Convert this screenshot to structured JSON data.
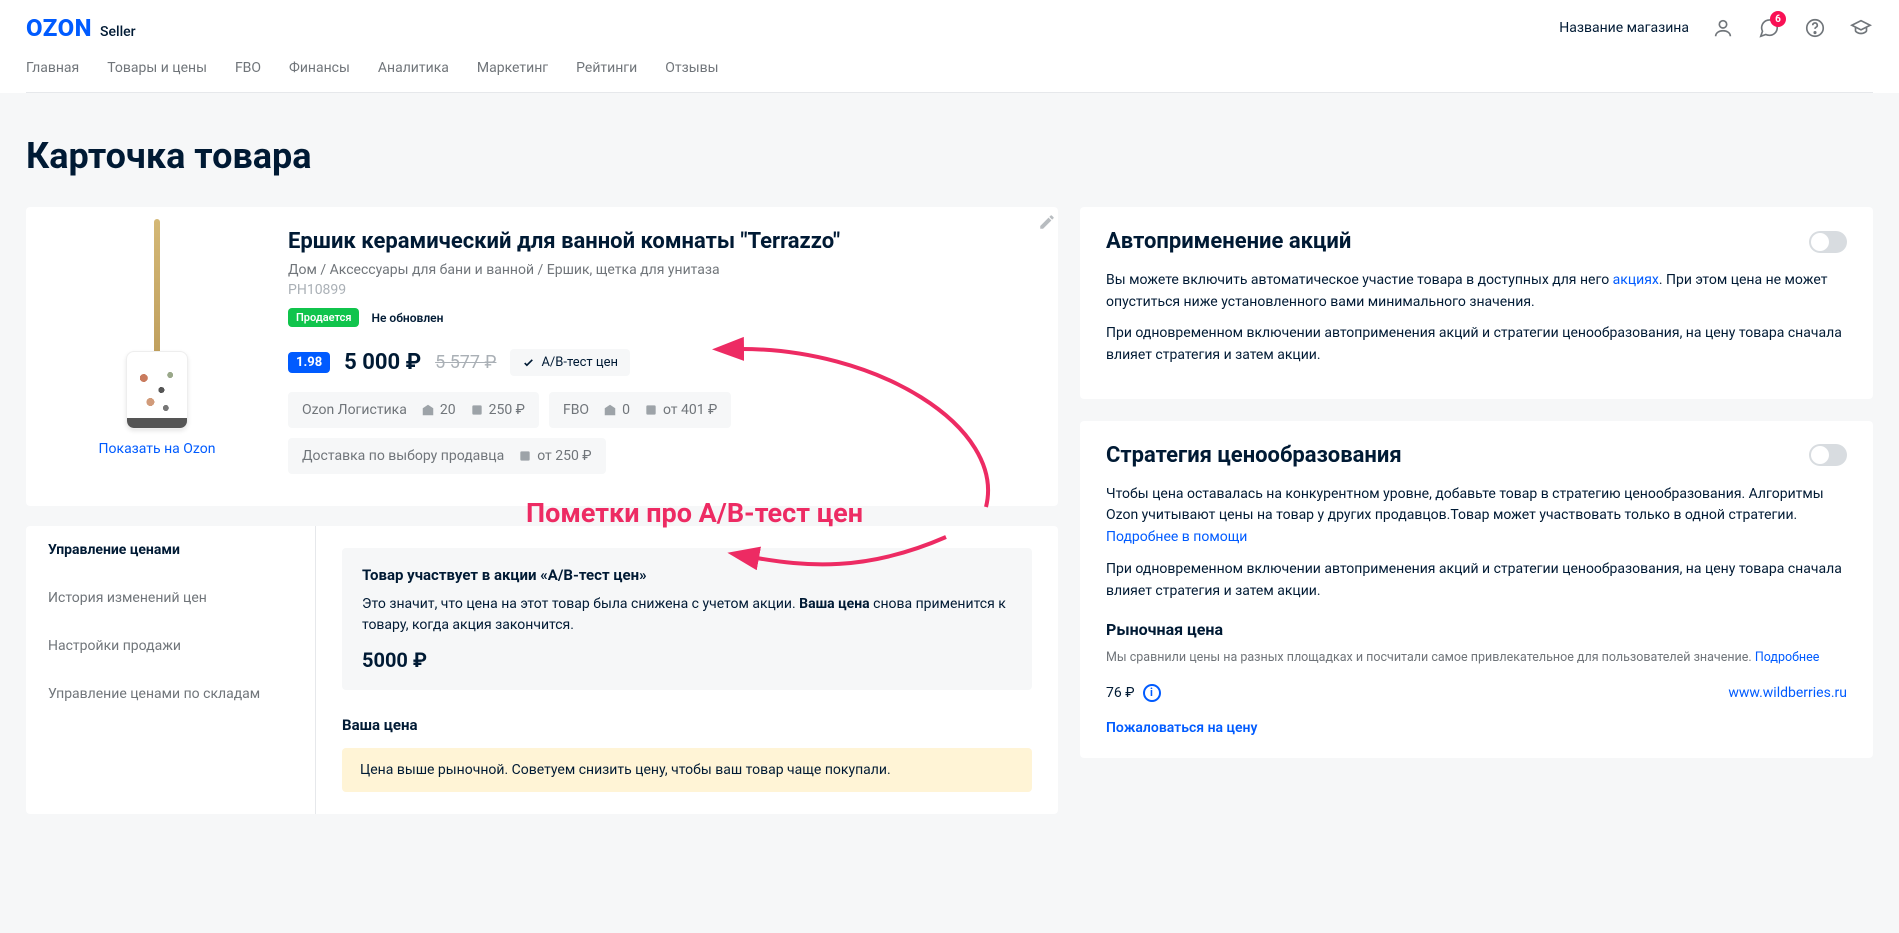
{
  "header": {
    "store_name": "Название магазина",
    "logo_brand": "OZON",
    "logo_sub": "Seller",
    "notif_count": "6",
    "nav": [
      "Главная",
      "Товары и цены",
      "FBO",
      "Финансы",
      "Аналитика",
      "Маркетинг",
      "Рейтинги",
      "Отзывы"
    ]
  },
  "page": {
    "title": "Карточка товара"
  },
  "product": {
    "title": "Ершик керамический для ванной комнаты \"Terrazzo\"",
    "breadcrumb": "Дом / Аксессуары для бани и ванной / Ершик, щетка для унитаза",
    "sku": "PH10899",
    "status_selling": "Продается",
    "status_not_updated": "Не обновлен",
    "rating": "1.98",
    "price": "5 000 ₽",
    "price_old": "5 577 ₽",
    "ab_test_label": "A/B-тест цен",
    "show_on_ozon": "Показать на Ozon",
    "logistics": {
      "ozon": {
        "label": "Ozon Логистика",
        "stock": "20",
        "from": "250 ₽"
      },
      "fbo": {
        "label": "FBO",
        "stock": "0",
        "from": "от 401 ₽"
      },
      "seller": {
        "label": "Доставка по выбору продавца",
        "from": "от 250 ₽"
      }
    }
  },
  "tabs": {
    "items": [
      "Управление ценами",
      "История изменений цен",
      "Настройки продажи",
      "Управление ценами по складам"
    ]
  },
  "pricing": {
    "box_title": "Товар участвует в акции «A/B-тест цен»",
    "box_text_1": "Это значит, что цена на этот товар была снижена с учетом акции. ",
    "box_text_bold": "Ваша цена",
    "box_text_2": " снова применится к товару, когда акция закончится.",
    "box_price": "5000 ₽",
    "your_price_label": "Ваша цена",
    "alert": "Цена выше рыночной. Советуем снизить цену, чтобы ваш товар чаще покупали."
  },
  "aside": {
    "auto": {
      "title": "Автоприменение акций",
      "p1a": "Вы можете включить автоматическое участие товара в доступных для него ",
      "p1_link": "акциях",
      "p1b": ". При этом цена не может опуститься ниже установленного вами минимального значения.",
      "p2": "При одновременном включении автоприменения акций и стратегии ценообразования, на цену товара сначала влияет стратегия и затем акции."
    },
    "strategy": {
      "title": "Стратегия ценообразования",
      "p1": "Чтобы цена оставалась на конкурентном уровне, добавьте товар в стратегию ценообразования. Алгоритмы Ozon учитывают цены на товар у других продавцов.Товар может участвовать только в одной стратегии.",
      "p1_link": "Подробнее в помощи",
      "p2": "При одновременном включении автоприменения акций и стратегии ценообразования, на цену товара сначала влияет стратегия и затем акции.",
      "market_label": "Рыночная цена",
      "market_desc": "Мы сравнили цены на разных площадках и посчитали самое привлекательное для пользователей значение. ",
      "market_more": "Подробнее",
      "market_price": "76 ₽",
      "market_source": "www.wildberries.ru",
      "complain": "Пожаловаться на цену"
    }
  },
  "annotation": {
    "text": "Пометки про A/B-тест цен"
  }
}
